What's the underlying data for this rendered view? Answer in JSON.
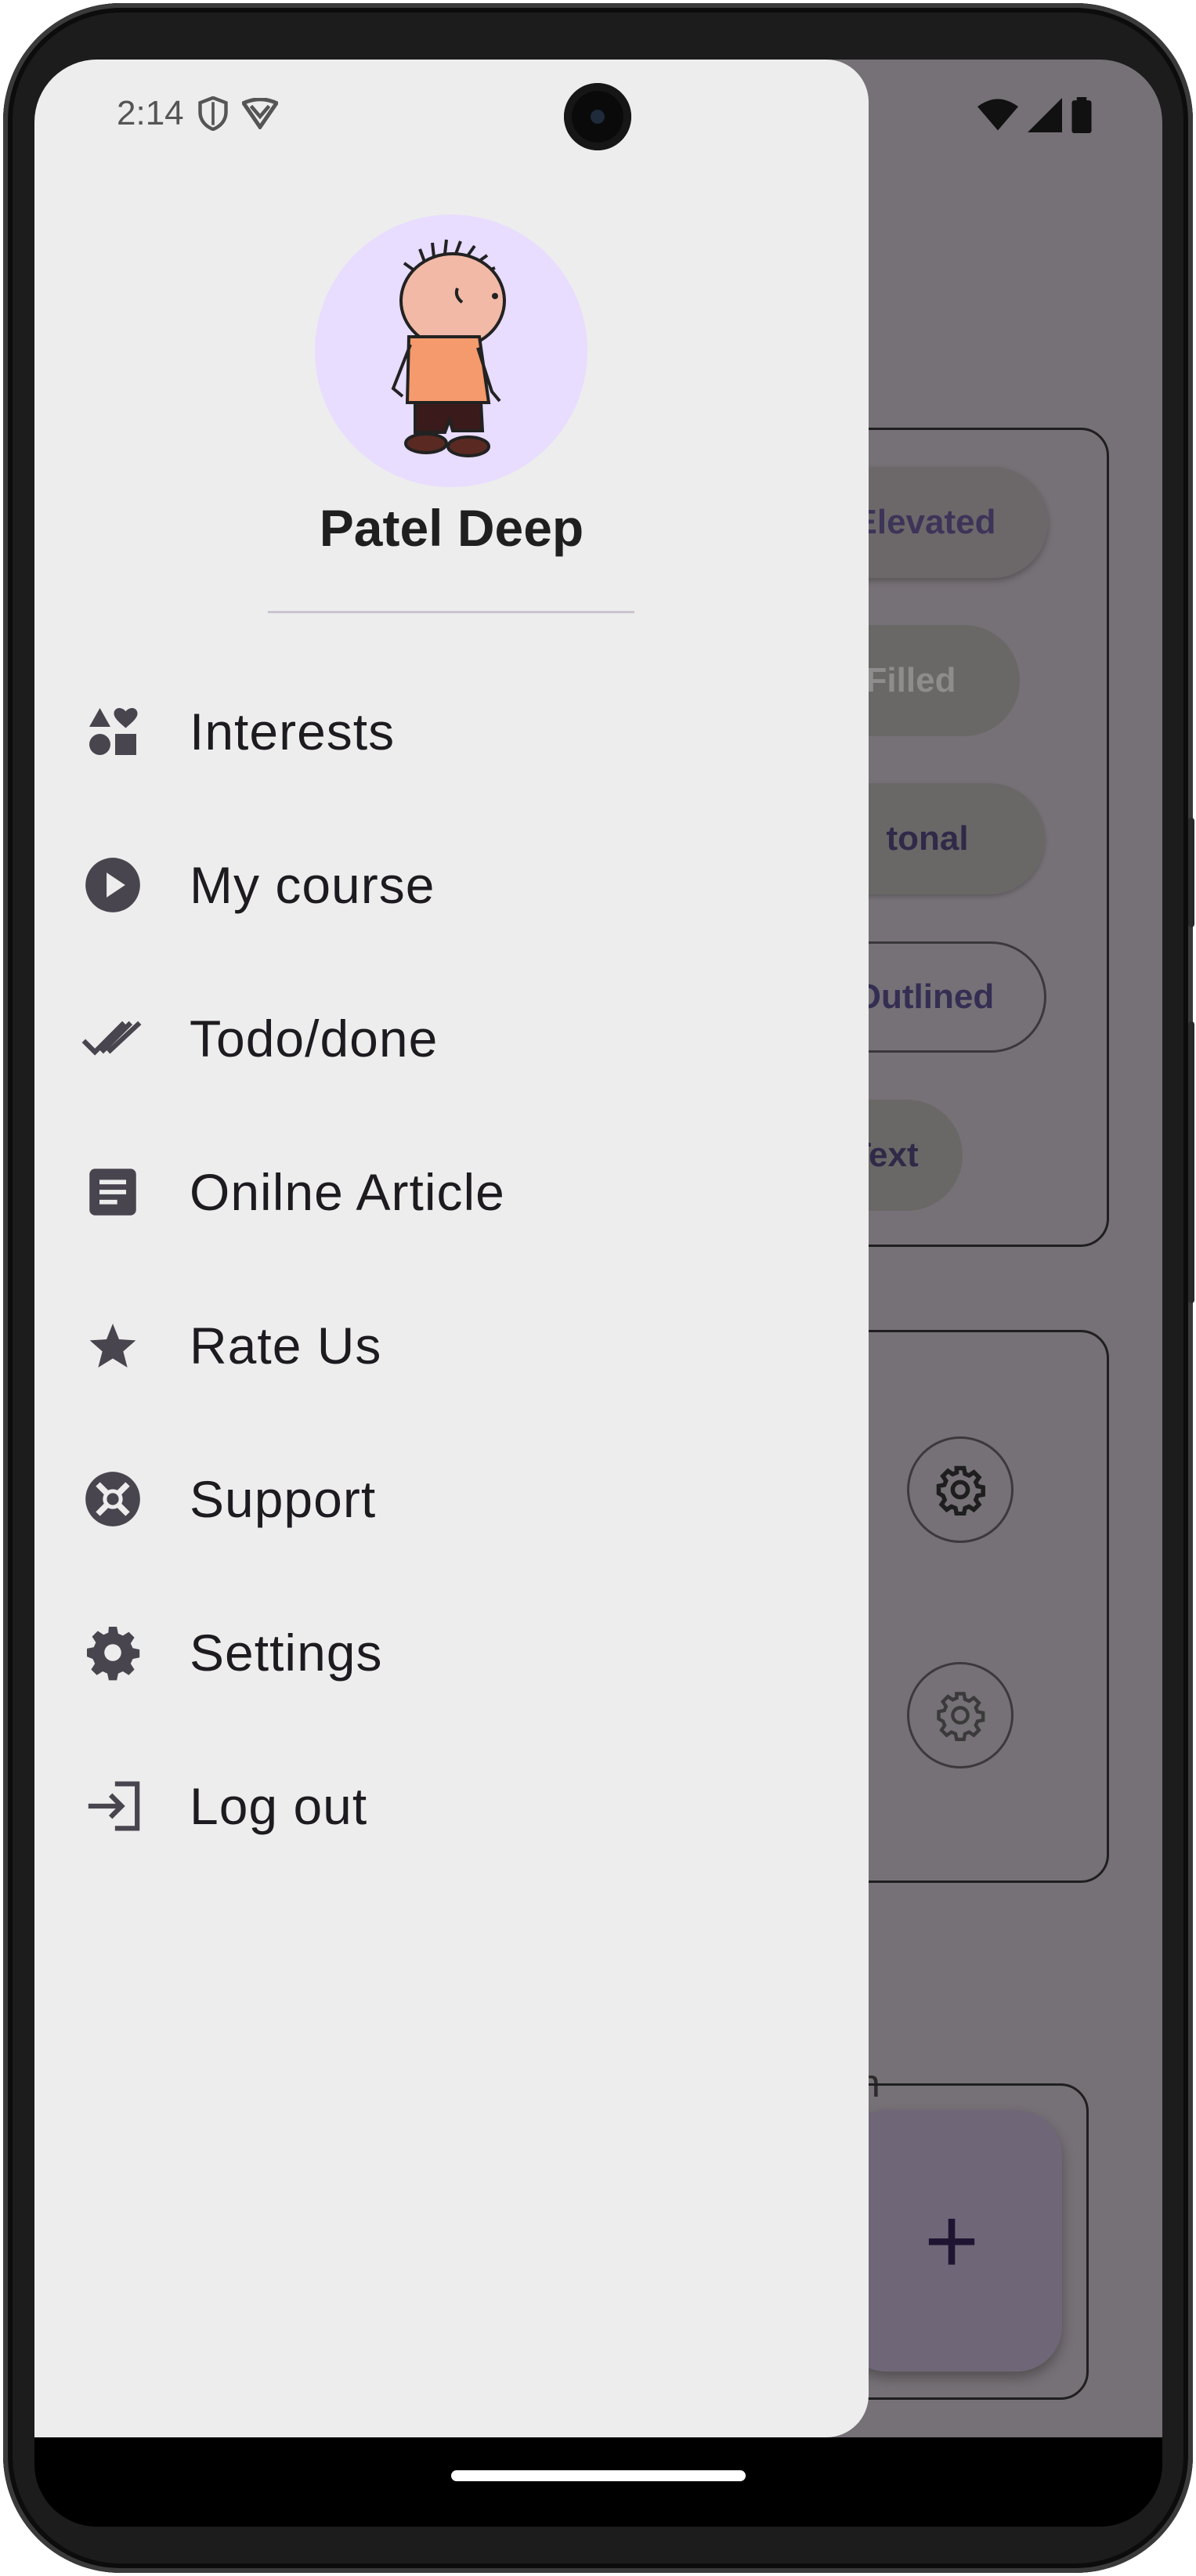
{
  "status_bar": {
    "time": "2:14"
  },
  "background_app": {
    "buttons": [
      "Elevated",
      "Filled",
      "tonal",
      "Outlined",
      "Text"
    ],
    "fab_label_fragment": "n",
    "fab_symbol": "+"
  },
  "drawer": {
    "user_name": "Patel Deep",
    "menu": [
      {
        "label": "Interests",
        "icon": "interests-icon"
      },
      {
        "label": "My course",
        "icon": "play-circle-icon"
      },
      {
        "label": "Todo/done",
        "icon": "done-all-icon"
      },
      {
        "label": "Onilne Article",
        "icon": "article-icon"
      },
      {
        "label": "Rate Us",
        "icon": "star-icon"
      },
      {
        "label": "Support",
        "icon": "support-icon"
      },
      {
        "label": "Settings",
        "icon": "gear-icon"
      },
      {
        "label": "Log out",
        "icon": "logout-icon"
      }
    ]
  },
  "colors": {
    "drawer_bg": "#ededed",
    "scrim": "#767176",
    "icon": "#49454f",
    "avatar_bg": "#e8dcff"
  }
}
